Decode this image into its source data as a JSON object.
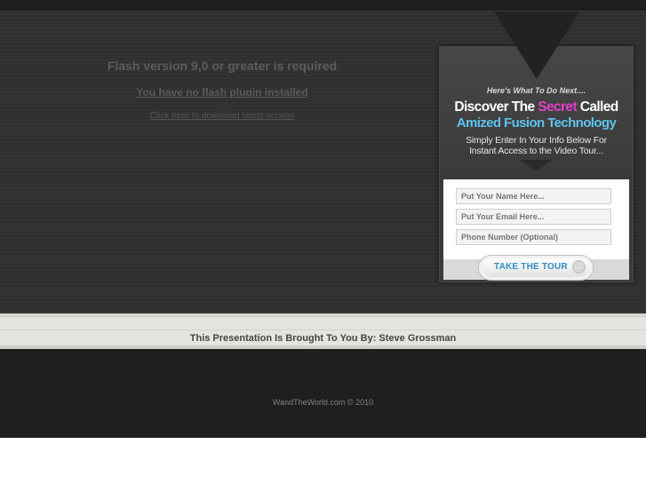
{
  "flash": {
    "title": "Flash version 9,0 or greater is required",
    "no_plugin_link": "You have no flash plugin installed",
    "download_link": "Click here to download latest version"
  },
  "optin": {
    "kicker": "Here's What To Do Next....",
    "headline_part1": "Discover The ",
    "headline_secret": "Secret",
    "headline_part2": " Called",
    "headline_line2": "Amized Fusion Technology",
    "sub_line1": "Simply Enter In Your Info Below For",
    "sub_line2": "Instant Access to the Video Tour...",
    "fields": {
      "name_placeholder": "Put Your Name Here...",
      "email_placeholder": "Put Your Email Here...",
      "phone_placeholder": "Phone Number (Optional)"
    },
    "button_label": "TAKE THE TOUR",
    "button_icon": "arrow-right-icon"
  },
  "presenter": {
    "text": "This Presentation Is Brought To You By:  Steve Grossman"
  },
  "footer": {
    "copyright": "WandTheWorld.com © 2010"
  },
  "colors": {
    "secret_accent": "#e040c8",
    "headline_blue": "#5ec4ee",
    "button_text": "#2f8fc4"
  }
}
